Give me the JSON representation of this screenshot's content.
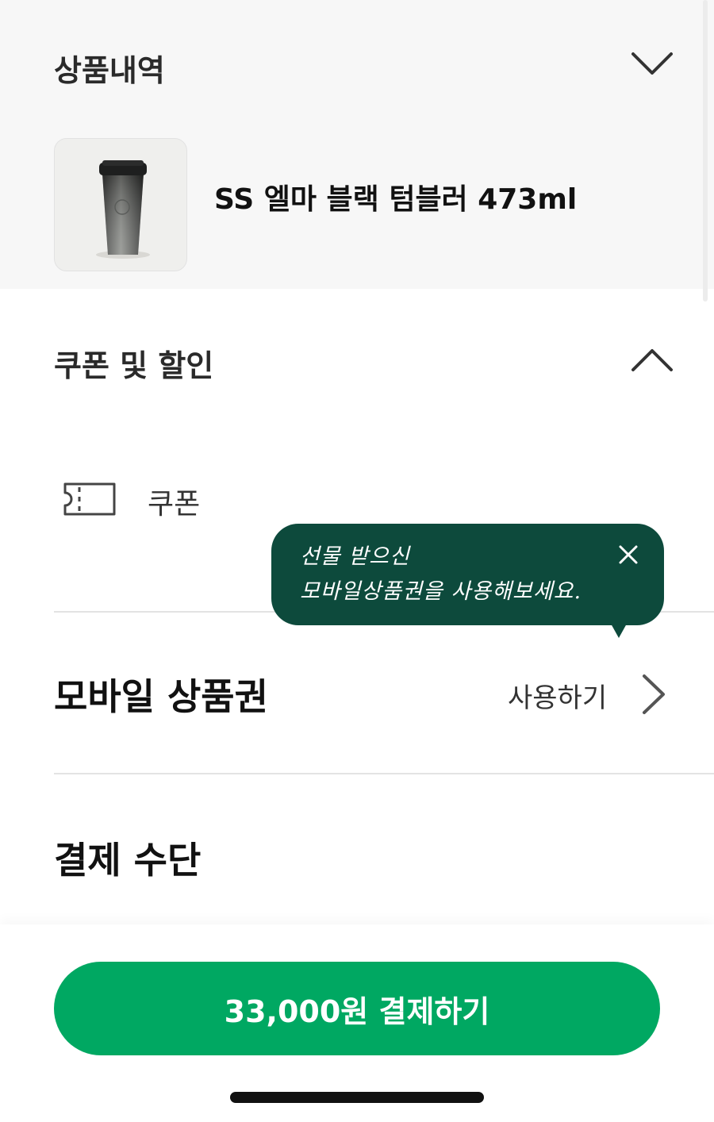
{
  "order": {
    "title": "상품내역",
    "toggle_icon": "chevron-down-icon",
    "product": {
      "name": "SS 엘마 블랙 텀블러 473ml",
      "image": "black-tumbler-image"
    }
  },
  "coupon_discount": {
    "title": "쿠폰 및 할인",
    "toggle_icon": "chevron-up-icon",
    "coupon": {
      "label": "쿠폰",
      "icon": "ticket-icon"
    }
  },
  "tooltip": {
    "text": "선물 받으신\n모바일상품권을 사용해보세요.",
    "close_icon": "close-icon"
  },
  "gift_card": {
    "title": "모바일 상품권",
    "action_label": "사용하기",
    "action_icon": "chevron-right-icon"
  },
  "payment_method": {
    "title": "결제 수단"
  },
  "pay_button": {
    "label": "33,000원 결제하기"
  },
  "colors": {
    "primary_green": "#00a862",
    "tooltip_green": "#0d4a3c",
    "background_gray": "#f7f7f7"
  }
}
